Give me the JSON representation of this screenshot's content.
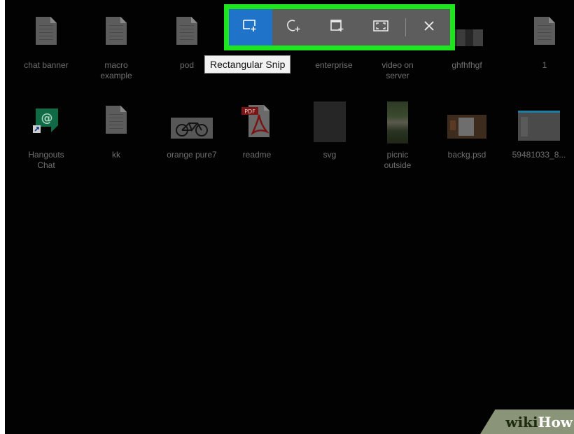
{
  "desktop": {
    "row1": [
      {
        "label": "chat banner",
        "icon": "document-icon"
      },
      {
        "label": "macro\nexample",
        "icon": "document-icon"
      },
      {
        "label": "pod",
        "icon": "document-icon"
      },
      {
        "label": "enterprise",
        "icon": "document-icon"
      },
      {
        "label": "video on\nserver",
        "icon": "video-thumbnail"
      },
      {
        "label": "ghfhfhgf",
        "icon": "image-thumbnail"
      },
      {
        "label": "1",
        "icon": "document-icon"
      }
    ],
    "row2": [
      {
        "label": "Hangouts\nChat",
        "icon": "hangouts-chat-icon"
      },
      {
        "label": "kk",
        "icon": "document-icon"
      },
      {
        "label": "orange pure7",
        "icon": "bicycle-thumbnail"
      },
      {
        "label": "readme",
        "icon": "pdf-icon",
        "badge": "PDF"
      },
      {
        "label": "svg",
        "icon": "svg-thumbnail"
      },
      {
        "label": "picnic\noutside",
        "icon": "photo-thumbnail"
      },
      {
        "label": "backg.psd",
        "icon": "psd-thumbnail"
      },
      {
        "label": "59481033_8...",
        "icon": "screenshot-thumbnail"
      }
    ]
  },
  "snip_toolbar": {
    "buttons": [
      {
        "name": "rectangular-snip",
        "icon": "rectangle-snip-icon",
        "active": true
      },
      {
        "name": "freeform-snip",
        "icon": "freeform-snip-icon",
        "active": false
      },
      {
        "name": "window-snip",
        "icon": "window-snip-icon",
        "active": false
      },
      {
        "name": "fullscreen-snip",
        "icon": "fullscreen-snip-icon",
        "active": false
      }
    ],
    "close_icon": "close-icon",
    "tooltip": "Rectangular Snip",
    "active_color": "#1f73c9",
    "highlight_color": "#1ee61e"
  },
  "watermark": {
    "part1": "wiki",
    "part2": "How"
  }
}
